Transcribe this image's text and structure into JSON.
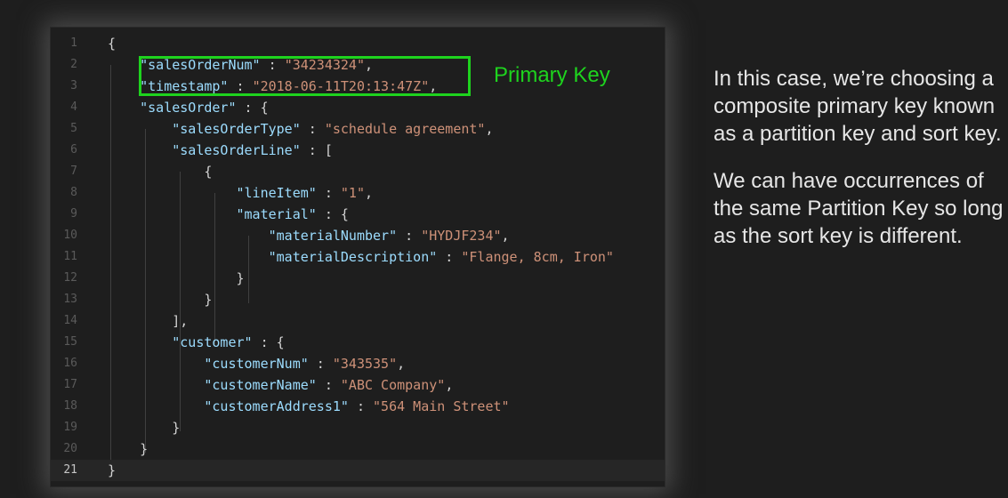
{
  "editor": {
    "lines": [
      {
        "n": "1",
        "parts": [
          {
            "t": "{",
            "c": "p"
          }
        ]
      },
      {
        "n": "2",
        "parts": [
          {
            "t": "    ",
            "c": "p"
          },
          {
            "t": "\"salesOrderNum\"",
            "c": "k"
          },
          {
            "t": " : ",
            "c": "p"
          },
          {
            "t": "\"34234324\"",
            "c": "s"
          },
          {
            "t": ",",
            "c": "p"
          }
        ]
      },
      {
        "n": "3",
        "parts": [
          {
            "t": "    ",
            "c": "p"
          },
          {
            "t": "\"timestamp\"",
            "c": "k"
          },
          {
            "t": " : ",
            "c": "p"
          },
          {
            "t": "\"2018-06-11T20:13:47Z\"",
            "c": "s"
          },
          {
            "t": ",",
            "c": "p"
          }
        ]
      },
      {
        "n": "4",
        "parts": [
          {
            "t": "    ",
            "c": "p"
          },
          {
            "t": "\"salesOrder\"",
            "c": "k"
          },
          {
            "t": " : {",
            "c": "p"
          }
        ]
      },
      {
        "n": "5",
        "parts": [
          {
            "t": "        ",
            "c": "p"
          },
          {
            "t": "\"salesOrderType\"",
            "c": "k"
          },
          {
            "t": " : ",
            "c": "p"
          },
          {
            "t": "\"schedule agreement\"",
            "c": "s"
          },
          {
            "t": ",",
            "c": "p"
          }
        ]
      },
      {
        "n": "6",
        "parts": [
          {
            "t": "        ",
            "c": "p"
          },
          {
            "t": "\"salesOrderLine\"",
            "c": "k"
          },
          {
            "t": " : [",
            "c": "p"
          }
        ]
      },
      {
        "n": "7",
        "parts": [
          {
            "t": "            {",
            "c": "p"
          }
        ]
      },
      {
        "n": "8",
        "parts": [
          {
            "t": "                ",
            "c": "p"
          },
          {
            "t": "\"lineItem\"",
            "c": "k"
          },
          {
            "t": " : ",
            "c": "p"
          },
          {
            "t": "\"1\"",
            "c": "s"
          },
          {
            "t": ",",
            "c": "p"
          }
        ]
      },
      {
        "n": "9",
        "parts": [
          {
            "t": "                ",
            "c": "p"
          },
          {
            "t": "\"material\"",
            "c": "k"
          },
          {
            "t": " : {",
            "c": "p"
          }
        ]
      },
      {
        "n": "10",
        "parts": [
          {
            "t": "                    ",
            "c": "p"
          },
          {
            "t": "\"materialNumber\"",
            "c": "k"
          },
          {
            "t": " : ",
            "c": "p"
          },
          {
            "t": "\"HYDJF234\"",
            "c": "s"
          },
          {
            "t": ",",
            "c": "p"
          }
        ]
      },
      {
        "n": "11",
        "parts": [
          {
            "t": "                    ",
            "c": "p"
          },
          {
            "t": "\"materialDescription\"",
            "c": "k"
          },
          {
            "t": " : ",
            "c": "p"
          },
          {
            "t": "\"Flange, 8cm, Iron\"",
            "c": "s"
          }
        ]
      },
      {
        "n": "12",
        "parts": [
          {
            "t": "                }",
            "c": "p"
          }
        ]
      },
      {
        "n": "13",
        "parts": [
          {
            "t": "            }",
            "c": "p"
          }
        ]
      },
      {
        "n": "14",
        "parts": [
          {
            "t": "        ],",
            "c": "p"
          }
        ]
      },
      {
        "n": "15",
        "parts": [
          {
            "t": "        ",
            "c": "p"
          },
          {
            "t": "\"customer\"",
            "c": "k"
          },
          {
            "t": " : {",
            "c": "p"
          }
        ]
      },
      {
        "n": "16",
        "parts": [
          {
            "t": "            ",
            "c": "p"
          },
          {
            "t": "\"customerNum\"",
            "c": "k"
          },
          {
            "t": " : ",
            "c": "p"
          },
          {
            "t": "\"343535\"",
            "c": "s"
          },
          {
            "t": ",",
            "c": "p"
          }
        ]
      },
      {
        "n": "17",
        "parts": [
          {
            "t": "            ",
            "c": "p"
          },
          {
            "t": "\"customerName\"",
            "c": "k"
          },
          {
            "t": " : ",
            "c": "p"
          },
          {
            "t": "\"ABC Company\"",
            "c": "s"
          },
          {
            "t": ",",
            "c": "p"
          }
        ]
      },
      {
        "n": "18",
        "parts": [
          {
            "t": "            ",
            "c": "p"
          },
          {
            "t": "\"customerAddress1\"",
            "c": "k"
          },
          {
            "t": " : ",
            "c": "p"
          },
          {
            "t": "\"564 Main Street\"",
            "c": "s"
          }
        ]
      },
      {
        "n": "19",
        "parts": [
          {
            "t": "        }",
            "c": "p"
          }
        ]
      },
      {
        "n": "20",
        "parts": [
          {
            "t": "    }",
            "c": "p"
          }
        ]
      },
      {
        "n": "21",
        "parts": [
          {
            "t": "}",
            "c": "p"
          }
        ],
        "active": true
      }
    ]
  },
  "annotation": {
    "label": "Primary Key",
    "color": "#1ed31e"
  },
  "explanation": {
    "paragraph1": "In this case, we’re choosing a composite primary key known as a partition key and sort key.",
    "paragraph2": "We can have occurrences of the same Partition Key so long as the sort key is different."
  },
  "colors": {
    "background": "#1e1e1e",
    "json_key": "#9cdcfe",
    "json_string": "#ce9178",
    "punctuation": "#d4d4d4",
    "line_number": "#5a5a5a"
  }
}
